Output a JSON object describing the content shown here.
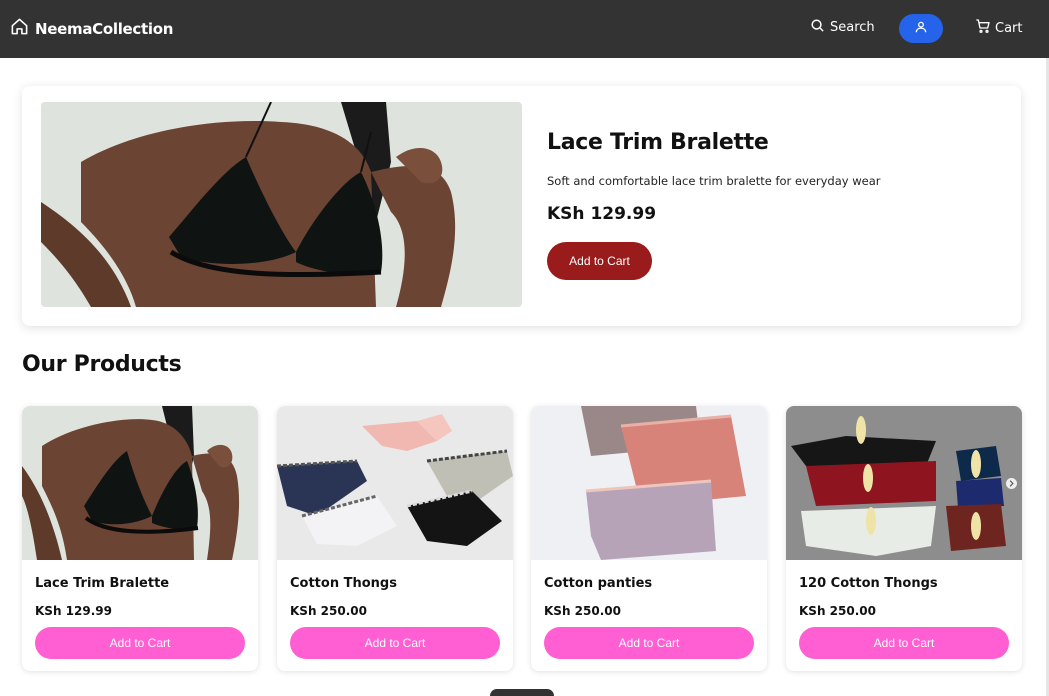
{
  "nav": {
    "brand": "NeemaCollection",
    "search_label": "Search",
    "cart_label": "Cart"
  },
  "hero": {
    "title": "Lace Trim Bralette",
    "description": "Soft and comfortable lace trim bralette for everyday wear",
    "price": "KSh 129.99",
    "button_label": "Add to Cart"
  },
  "section_title": "Our Products",
  "products": [
    {
      "name": "Lace Trim Bralette",
      "price": "KSh 129.99",
      "button_label": "Add to Cart"
    },
    {
      "name": "Cotton Thongs",
      "price": "KSh 250.00",
      "button_label": "Add to Cart"
    },
    {
      "name": "Cotton panties",
      "price": "KSh 250.00",
      "button_label": "Add to Cart"
    },
    {
      "name": "120 Cotton Thongs",
      "price": "KSh 250.00",
      "button_label": "Add to Cart"
    }
  ],
  "colors": {
    "nav_bg": "#333333",
    "user_button": "#2563eb",
    "hero_button": "#991b1b",
    "card_button": "#ff5fd2"
  }
}
